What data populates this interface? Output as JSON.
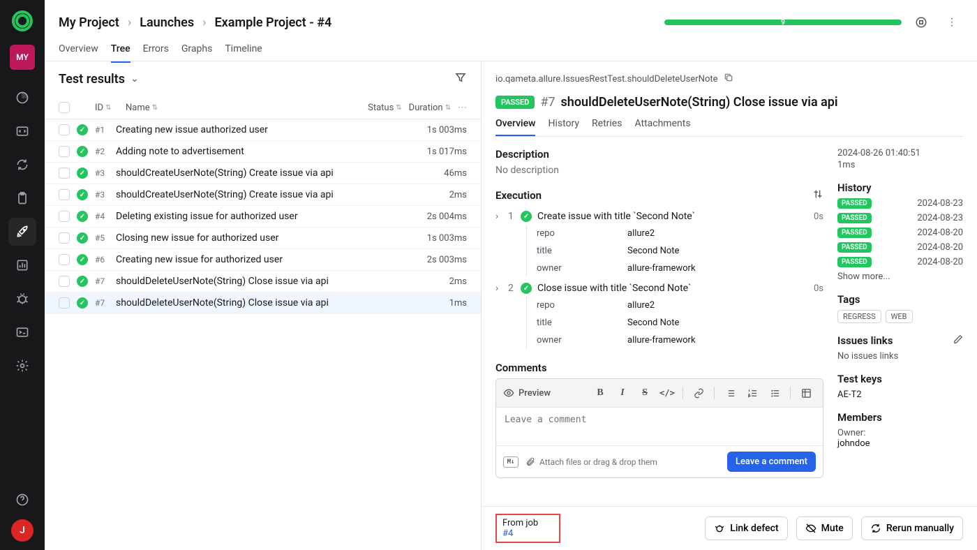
{
  "sidebar": {
    "project_badge": "MY",
    "user_avatar": "J"
  },
  "breadcrumb": [
    "My Project",
    "Launches",
    "Example Project - #4"
  ],
  "progress_count": "9",
  "tabs": [
    "Overview",
    "Tree",
    "Errors",
    "Graphs",
    "Timeline"
  ],
  "left_title": "Test results",
  "columns": {
    "id": "ID",
    "name": "Name",
    "status": "Status",
    "duration": "Duration"
  },
  "rows": [
    {
      "num": "#1",
      "name": "Creating new issue authorized user",
      "dur": "1s 003ms"
    },
    {
      "num": "#2",
      "name": "Adding note to advertisement",
      "dur": "1s 017ms"
    },
    {
      "num": "#3",
      "name": "shouldCreateUserNote(String) Create issue via api",
      "dur": "46ms"
    },
    {
      "num": "#3",
      "name": "shouldCreateUserNote(String) Create issue via api",
      "dur": "2ms"
    },
    {
      "num": "#4",
      "name": "Deleting existing issue for authorized user",
      "dur": "2s 004ms"
    },
    {
      "num": "#5",
      "name": "Closing new issue for authorized user",
      "dur": "1s 003ms"
    },
    {
      "num": "#6",
      "name": "Creating new issue for authorized user",
      "dur": "2s 003ms"
    },
    {
      "num": "#7",
      "name": "shouldDeleteUserNote(String) Close issue via api",
      "dur": "2ms"
    },
    {
      "num": "#7",
      "name": "shouldDeleteUserNote(String) Close issue via api",
      "dur": "1ms"
    }
  ],
  "detail": {
    "qname": "io.qameta.allure.IssuesRestTest.shouldDeleteUserNote",
    "status": "PASSED",
    "num": "#7",
    "title": "shouldDeleteUserNote(String) Close issue via api",
    "tabs": [
      "Overview",
      "History",
      "Retries",
      "Attachments"
    ],
    "desc_h": "Description",
    "desc_none": "No description",
    "exec_h": "Execution",
    "steps": [
      {
        "n": "1",
        "name": "Create issue with title `Second Note`",
        "dur": "0s",
        "params": [
          [
            "repo",
            "allure2"
          ],
          [
            "title",
            "Second Note"
          ],
          [
            "owner",
            "allure-framework"
          ]
        ]
      },
      {
        "n": "2",
        "name": "Close issue with title `Second Note`",
        "dur": "0s",
        "params": [
          [
            "repo",
            "allure2"
          ],
          [
            "title",
            "Second Note"
          ],
          [
            "owner",
            "allure-framework"
          ]
        ]
      }
    ],
    "comments_h": "Comments",
    "preview": "Preview",
    "placeholder": "Leave a comment",
    "attach": "Attach files or drag & drop them",
    "leave_btn": "Leave a comment"
  },
  "side": {
    "date": "2024-08-26 01:40:51",
    "dur": "1ms",
    "hist_h": "History",
    "history": [
      {
        "s": "PASSED",
        "d": "2024-08-23"
      },
      {
        "s": "PASSED",
        "d": "2024-08-23"
      },
      {
        "s": "PASSED",
        "d": "2024-08-20"
      },
      {
        "s": "PASSED",
        "d": "2024-08-20"
      },
      {
        "s": "PASSED",
        "d": "2024-08-20"
      }
    ],
    "show_more": "Show more...",
    "tags_h": "Tags",
    "tags": [
      "REGRESS",
      "WEB"
    ],
    "issues_h": "Issues links",
    "issues_none": "No issues links",
    "keys_h": "Test keys",
    "key": "AE-T2",
    "members_h": "Members",
    "owner_lbl": "Owner:",
    "owner": "johndoe"
  },
  "footer": {
    "from_job": "From job",
    "job_link": "#4",
    "link_defect": "Link defect",
    "mute": "Mute",
    "rerun": "Rerun manually"
  }
}
